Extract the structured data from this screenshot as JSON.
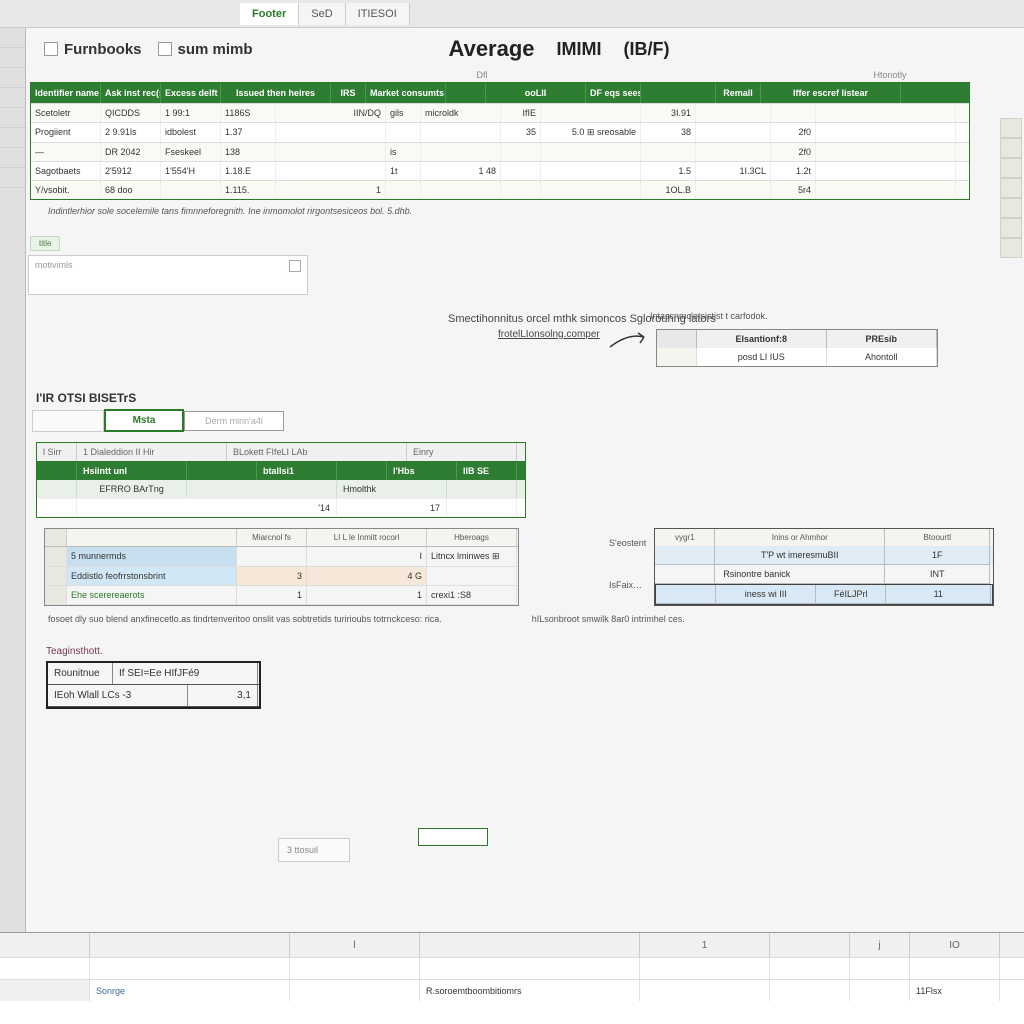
{
  "tabs": {
    "t1": "Footer",
    "t2": "SeD",
    "t3": "ITIESOI"
  },
  "header": {
    "left1": "Furnbooks",
    "left2": "sum mimb",
    "title": "Average",
    "code1": "IMIMI",
    "code2": "(IB/F)"
  },
  "subhdr": {
    "a": "Dfl",
    "b": "Htonotly"
  },
  "main_table": {
    "headers": [
      "Identifier name",
      "Ask inst rec(stat)",
      "Excess delft",
      "Issued then heires",
      "IRS",
      "Market consumts",
      "ooLII",
      "DF eqs seess",
      "Remall",
      "Iffer escref listear"
    ],
    "rows": [
      [
        "Scetoletr",
        "QICDDS",
        "1 99:1",
        "1186S",
        "IIN/DQ",
        "gils",
        "microldk",
        "IfIE",
        "",
        "3I.91",
        "",
        "",
        ""
      ],
      [
        "Progiient",
        "2 9.91ls",
        "idbolest",
        "1.37",
        "",
        "",
        "",
        "35",
        "",
        "5.0 ⊞ sreosable",
        "38",
        "",
        "2f0"
      ],
      [
        "—",
        "DR 2042",
        "Fseskeel",
        "138",
        "",
        "is",
        "",
        "",
        "",
        "",
        "",
        "",
        "2f0"
      ],
      [
        "Sagotbaets",
        "2'5912",
        "1'554'H",
        "1.18.E",
        "",
        "1t",
        "1 48",
        "",
        "",
        "1.5",
        "",
        "1I.3CL",
        "1.2t"
      ],
      [
        "Y/vsobit.",
        "68 doo",
        "",
        "1.115.",
        "1",
        "",
        "",
        "",
        "",
        "1OL.B",
        "",
        "",
        "5r4"
      ]
    ]
  },
  "caption1": "Indintlerhior sole socelemile tans fimnneforegnith. Ine inmomolot rirgontsesiceos bol. 5.dhb.",
  "tag": "title",
  "searchPlaceholders": {
    "a": "motivimls",
    "b": "—"
  },
  "midSubtitle": "Smectihonnitus orcel mthk simoncos Sglorouhng lators",
  "callout": {
    "label": "Intascnmcletsistist t carfodok.",
    "link": "frotelLIonsolng.comper"
  },
  "miniTable": {
    "h1": "Elsantionf:8",
    "h2": "PREsib",
    "r1": "posd LI IUS",
    "r2": "Ahontoll"
  },
  "sectionLabel": "I'IR OTSI BISETrS",
  "inputStrip": {
    "sel": "Msta",
    "muted": "Derm minn'a4l"
  },
  "greenBox": {
    "h": [
      "l Sirr",
      "1 Dialeddion II Hir",
      "BLokett FIfeLI LAb",
      "Einry"
    ],
    "sub": [
      "Hsiintt unl",
      "",
      "",
      "btallsi1",
      "",
      "l'Hbs",
      "IlB SE"
    ],
    "light": [
      "",
      "EFRRO BArTng",
      "",
      "",
      "",
      "Hmolthk",
      ""
    ],
    "row": [
      "",
      "",
      "",
      "'14",
      "",
      "17",
      ""
    ]
  },
  "softTable": {
    "headers": [
      "",
      "Miarcnol fs",
      "LI L le Inmitt rocorl",
      "Hberoags"
    ],
    "rows": [
      [
        "5 munnermds",
        "",
        "I",
        "Litncx lminwes ⊞"
      ],
      [
        "Eddistlo feofrrstonsbrint",
        "3",
        "4 G",
        ""
      ],
      [
        "Ehe scerereaerots",
        "1",
        "1",
        "crexi1 :S8"
      ]
    ]
  },
  "sideLabels": {
    "a": "S'eostent",
    "b": "IsFaix…"
  },
  "blueTable": {
    "headers": [
      "vygr1",
      "Inins or Ahmhor",
      "Btoourtl"
    ],
    "rows": [
      [
        "T'P wt imeresmuBII",
        "1F"
      ],
      [
        "Rsinontre banick",
        "INT",
        ""
      ],
      [
        "iness wi III",
        "FéILJPrl",
        "11"
      ]
    ]
  },
  "caption2a": "fosoet dly suo blend anxfinecetlo.as tindrtenveritoo onslit vas sobtretids turirioubs totrnckceso: rica.",
  "caption2b": "hILsonbroot smwilk 8ar0 intrimhel ces.",
  "formulaLabel": "Teaginsthott.",
  "formulaTable": {
    "r1": [
      "Rounitnue",
      "If SEI=Ee HIfJFé9"
    ],
    "r2": [
      "IEoh Wlall LCs -3",
      "3,1"
    ]
  },
  "sidePill": "3 ttosuil",
  "bottomGrid": {
    "headers": [
      "",
      "",
      "l",
      "",
      "1",
      "",
      "j",
      "IO"
    ],
    "row": [
      "",
      "Sonrge",
      "",
      "R.soroemtboombitiomrs",
      "",
      "",
      "",
      "11Flsx"
    ]
  }
}
